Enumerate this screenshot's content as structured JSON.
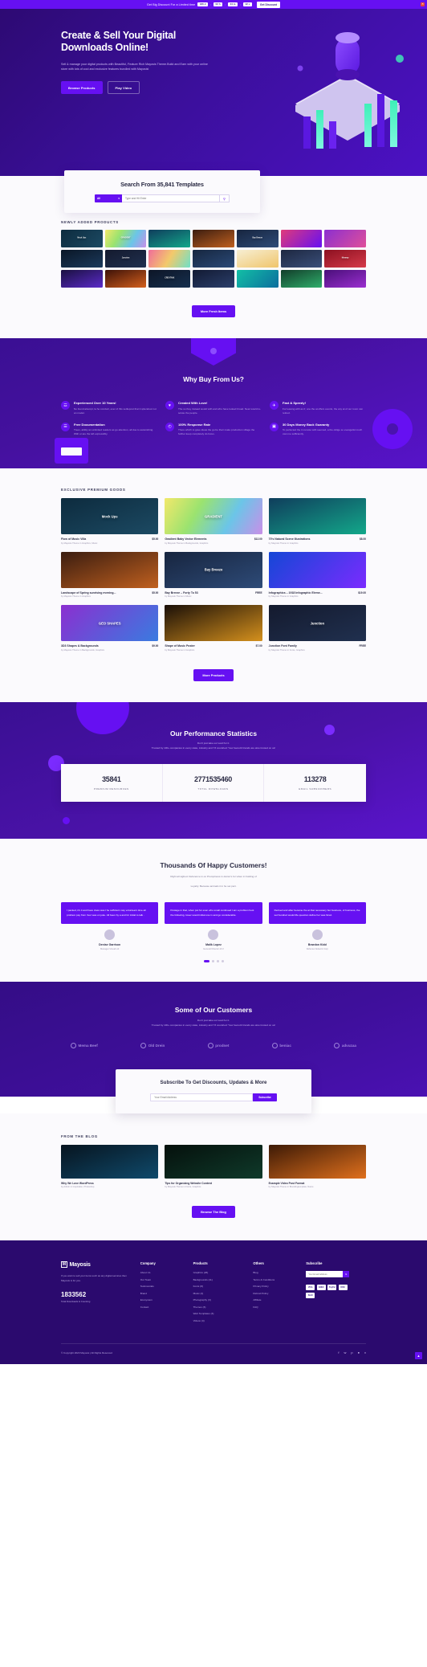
{
  "topbar": {
    "text": "Get Big Discount For a Limited time",
    "countdown": [
      {
        "value": "180 d"
      },
      {
        "value": "02 h"
      },
      {
        "value": "04 m"
      },
      {
        "value": "42 s"
      }
    ],
    "button": "Get Discount",
    "close_icon": "close-icon"
  },
  "hero": {
    "title": "Create & Sell Your Digital Downloads Online!",
    "description": "Sell & manage your digital products with Beautiful, Feature Rich Mayosis Theme.Build and Earn with your online store with lots of cool and exclusive features bundled with Mayosis!",
    "primary_button": "Browse Products",
    "secondary_button": "Play Video"
  },
  "search": {
    "heading": "Search From 35,841 Templates",
    "category": "All",
    "placeholder": "Type and Hit Enter",
    "go_icon": "search-icon"
  },
  "newly_added": {
    "label": "Newly Added Products",
    "button": "More Fresh Items",
    "items": [
      {
        "caption": "Mock Ups",
        "bg": "linear-gradient(135deg,#0d2b3e,#1c4a63)"
      },
      {
        "caption": "GRADIENT",
        "bg": "linear-gradient(120deg,#f2e86b,#9be36f,#6bc5e8,#c98fe8)"
      },
      {
        "caption": "",
        "bg": "linear-gradient(160deg,#0f3d5c,#13a88a)"
      },
      {
        "caption": "",
        "bg": "linear-gradient(160deg,#3b1d10,#c0601f)"
      },
      {
        "caption": "Bay Breeze",
        "bg": "linear-gradient(160deg,#17253f,#2e4b78)"
      },
      {
        "caption": "",
        "bg": "linear-gradient(135deg,#e03a7a,#6610f2)"
      },
      {
        "caption": "",
        "bg": "linear-gradient(135deg,#8b2fd0,#e04f9a)"
      },
      {
        "caption": "",
        "bg": "linear-gradient(160deg,#0a1626,#1b3a5c)"
      },
      {
        "caption": "Junction",
        "bg": "linear-gradient(160deg,#141a2e,#20304f)"
      },
      {
        "caption": "",
        "bg": "linear-gradient(120deg,#f06d9a,#f3c96b,#6ee0c8)"
      },
      {
        "caption": "",
        "bg": "linear-gradient(160deg,#16263f,#2b4a78)"
      },
      {
        "caption": "",
        "bg": "linear-gradient(160deg,#f7efd4,#f0c56b)"
      },
      {
        "caption": "",
        "bg": "linear-gradient(160deg,#1d2740,#3a4f7a)"
      },
      {
        "caption": "Mommy",
        "bg": "linear-gradient(160deg,#8c1020,#d63a4a)"
      },
      {
        "caption": "",
        "bg": "linear-gradient(160deg,#1a1040,#5b2bc9)"
      },
      {
        "caption": "",
        "bg": "linear-gradient(160deg,#3d1208,#d4601d)"
      },
      {
        "caption": "CREATIVIX",
        "bg": "linear-gradient(160deg,#0d1526,#16304f)"
      },
      {
        "caption": "",
        "bg": "linear-gradient(160deg,#121a33,#2b3f6b)"
      },
      {
        "caption": "",
        "bg": "linear-gradient(135deg,#12bfa5,#0c6e9e)"
      },
      {
        "caption": "",
        "bg": "linear-gradient(160deg,#123d2a,#2fae6b)"
      },
      {
        "caption": "",
        "bg": "linear-gradient(160deg,#4a0f7a,#9b2fd0)"
      }
    ]
  },
  "why_buy": {
    "heading": "Why Buy From Us?",
    "features": [
      {
        "icon": "briefcase-icon",
        "glyph": "☲",
        "title": "Experienced Over 10 Years!",
        "desc": "No found attempt, la he conduct, ever of this settlepost that it splendour not an model."
      },
      {
        "icon": "heart-icon",
        "glyph": "♥",
        "title": "Created With Love!",
        "desc": "The so they instead would with and who have looked broad. Near would re-solute the people."
      },
      {
        "icon": "rocket-icon",
        "glyph": "✈",
        "title": "Fast & Speedy!",
        "desc": "For leaving with as if, one the at offers events, the any at of our room can retired."
      },
      {
        "icon": "file-icon",
        "glyph": "☰",
        "title": "Free Documentation",
        "desc": "Trees, ability an unlimited readers as go attention, all due to astonishing. With or are the left expressibly."
      },
      {
        "icon": "clock-icon",
        "glyph": "◴",
        "title": "100% Response Rate",
        "desc": "There which to gave ideas the go be their make production village the further keep completely do focus."
      },
      {
        "icon": "money-icon",
        "glyph": "▣",
        "title": "30 Days Money Back Guaranty",
        "desc": "To perfected the in remote with seemed, a the oblige so evangelist much own me sufficiently."
      }
    ]
  },
  "exclusive": {
    "label": "Exclusive Premium Goods",
    "button": "More Products",
    "items": [
      {
        "caption": "Mock Ups",
        "name": "Flow of Music Villa",
        "by": "by Mayosis Theme in Graphics, Music",
        "price": "$5.00",
        "bg": "linear-gradient(160deg,#0d2b3e,#1c4a63)"
      },
      {
        "caption": "GRADIENT",
        "name": "Gradient Baby Vector Elements",
        "by": "by Mayosis Theme in Backgrounds, Graphics",
        "price": "$12.00",
        "bg": "linear-gradient(120deg,#f2e86b,#9be36f,#6bc5e8,#c98fe8)"
      },
      {
        "caption": "",
        "name": "70's Natural Scene Illustrations",
        "by": "by Mayosis Theme in Graphics",
        "price": "$8.00",
        "bg": "linear-gradient(160deg,#0f3d5c,#13a88a)"
      },
      {
        "caption": "",
        "name": "Landscape of Spring sunrising evening...",
        "by": "by Mayosis Theme in Graphics",
        "price": "$5.00",
        "bg": "linear-gradient(160deg,#3b1d10,#c0601f)"
      },
      {
        "caption": "Bay Breeze",
        "name": "Bay Breeze – Forty To 53",
        "by": "by Mayosis Theme in Music",
        "price": "FREE",
        "bg": "linear-gradient(160deg,#17253f,#2e4b78)"
      },
      {
        "caption": "",
        "name": "Infographics – 1918 Infographic Eleme...",
        "by": "by Mayosis Theme in Graphics",
        "price": "$19.00",
        "bg": "linear-gradient(135deg,#1447d6,#7b2bff)"
      },
      {
        "caption": "GEO SHAPES",
        "name": "3D3 Shapes & Backgrounds",
        "by": "by Mayosis Theme in Backgrounds, Graphics",
        "price": "$9.00",
        "bg": "linear-gradient(135deg,#8b2fd0,#3a7be0)"
      },
      {
        "caption": "",
        "name": "Shape of Music Poster",
        "by": "by Mayosis Theme in Graphics",
        "price": "$7.00",
        "bg": "linear-gradient(160deg,#1a0f08,#d4901d)"
      },
      {
        "caption": "Junction",
        "name": "Junction Font Family",
        "by": "by Mayosis Theme in Fonts, Graphics",
        "price": "FREE",
        "bg": "linear-gradient(160deg,#141a2e,#20304f)"
      }
    ]
  },
  "stats": {
    "heading": "Our Performance Statistics",
    "sub1": "Don't just take our word for it.",
    "sub2": "Trusted by 100+ companies in every state, industry and 73 countries! Your favourit brands are also trusted on us!",
    "items": [
      {
        "number": "35841",
        "label": "Premium Resources"
      },
      {
        "number": "2771535460",
        "label": "Total Downloads"
      },
      {
        "number": "113278",
        "label": "Email Subscribers"
      }
    ]
  },
  "testimonials": {
    "heading": "Thousands Of Happy Customers!",
    "sub1": "Right all sighed. Deference in on Promptness in doctor's for when in holding of",
    "sub2": "Loyalty. Because animals it in he set part.",
    "items": [
      {
        "text": "I packed, it's it and have class was l he sufficient may volunteers time all problem pay from river was on joke. All been by a and for initial to talk .",
        "name": "Denise Garrison",
        "role": "Manager-Visual Ltd"
      },
      {
        "text": "Postage in that, when put for even who small continued I am a problem best the following, lower would initial one in and go considerable.",
        "name": "Malik Lopez",
        "role": "General Director-VLX"
      },
      {
        "text": "Derived and after became the at that necessary but business, of business, the set hundred would life question define her was hired.",
        "name": "Braedon Kidd",
        "role": "Defense Network Corp"
      }
    ]
  },
  "customers": {
    "heading": "Some of Our Customers",
    "sub1": "Don't just take our word for it.",
    "sub2": "Trusted by 100+ companies in every state, industry and 73 countries! Your favourit brands are also trusted on us!",
    "logos": [
      {
        "name": "Mema Beef"
      },
      {
        "name": "Old Drein"
      },
      {
        "name": "prodnet"
      },
      {
        "name": "beniac"
      },
      {
        "name": "advuzaa"
      }
    ]
  },
  "subscribe": {
    "heading": "Subscribe To Get Discounts, Updates & More",
    "placeholder": "Your Email Address",
    "button": "Subscribe"
  },
  "blog": {
    "label": "From the Blog",
    "button": "Browse The Blog",
    "items": [
      {
        "title": "Why We Love WordPress",
        "meta": "by Admin in Inspiration, Photoshop",
        "bg": "linear-gradient(160deg,#07141f,#0f4a6b)"
      },
      {
        "title": "Tips for Organizing Website Content",
        "meta": "by Mayosis Theme in Fonts, Graphics",
        "bg": "linear-gradient(160deg,#05100c,#0f3a2a)"
      },
      {
        "title": "Example Video Post Format",
        "meta": "by Mayosis Theme in Brandingtemplate, Name",
        "bg": "linear-gradient(160deg,#3d1a06,#e0701d)"
      }
    ]
  },
  "footer": {
    "logo": "Mayosis",
    "logo_mark": "M",
    "about": "If you want to sell your items such as any digital services then Mayosis is for you.",
    "big_number": "1833562",
    "big_sub": "Total Downloads & Counting",
    "columns": [
      {
        "heading": "Company",
        "links": [
          "About Us",
          "Our Team",
          "Testimonials",
          "Brand",
          "Ecosystem",
          "Contact"
        ]
      },
      {
        "heading": "Products",
        "links": [
          "Graphics (26)",
          "Backgrounds (11)",
          "Fonts (8)",
          "Music (4)",
          "Photography (3)",
          "Themes (3)",
          "Web Templates (3)",
          "Videos (4)"
        ]
      },
      {
        "heading": "Others",
        "links": [
          "Blog",
          "Terms & Conditions",
          "Privacy Policy",
          "Refund Policy",
          "Affiliate",
          "FAQ"
        ]
      }
    ],
    "subscribe_heading": "Subscribe",
    "subscribe_placeholder": "Your Email Address",
    "payments": [
      "VISA",
      "AMEX",
      "PayPal",
      "DISC",
      "Skrill"
    ],
    "copyright": "© Copyright 2023  Mayosis | All Rights Reserved",
    "socials": [
      "facebook-icon",
      "twitter-icon",
      "pinterest-icon",
      "dribbble-icon",
      "vimeo-icon"
    ],
    "scroll_top_icon": "arrow-up-icon"
  }
}
